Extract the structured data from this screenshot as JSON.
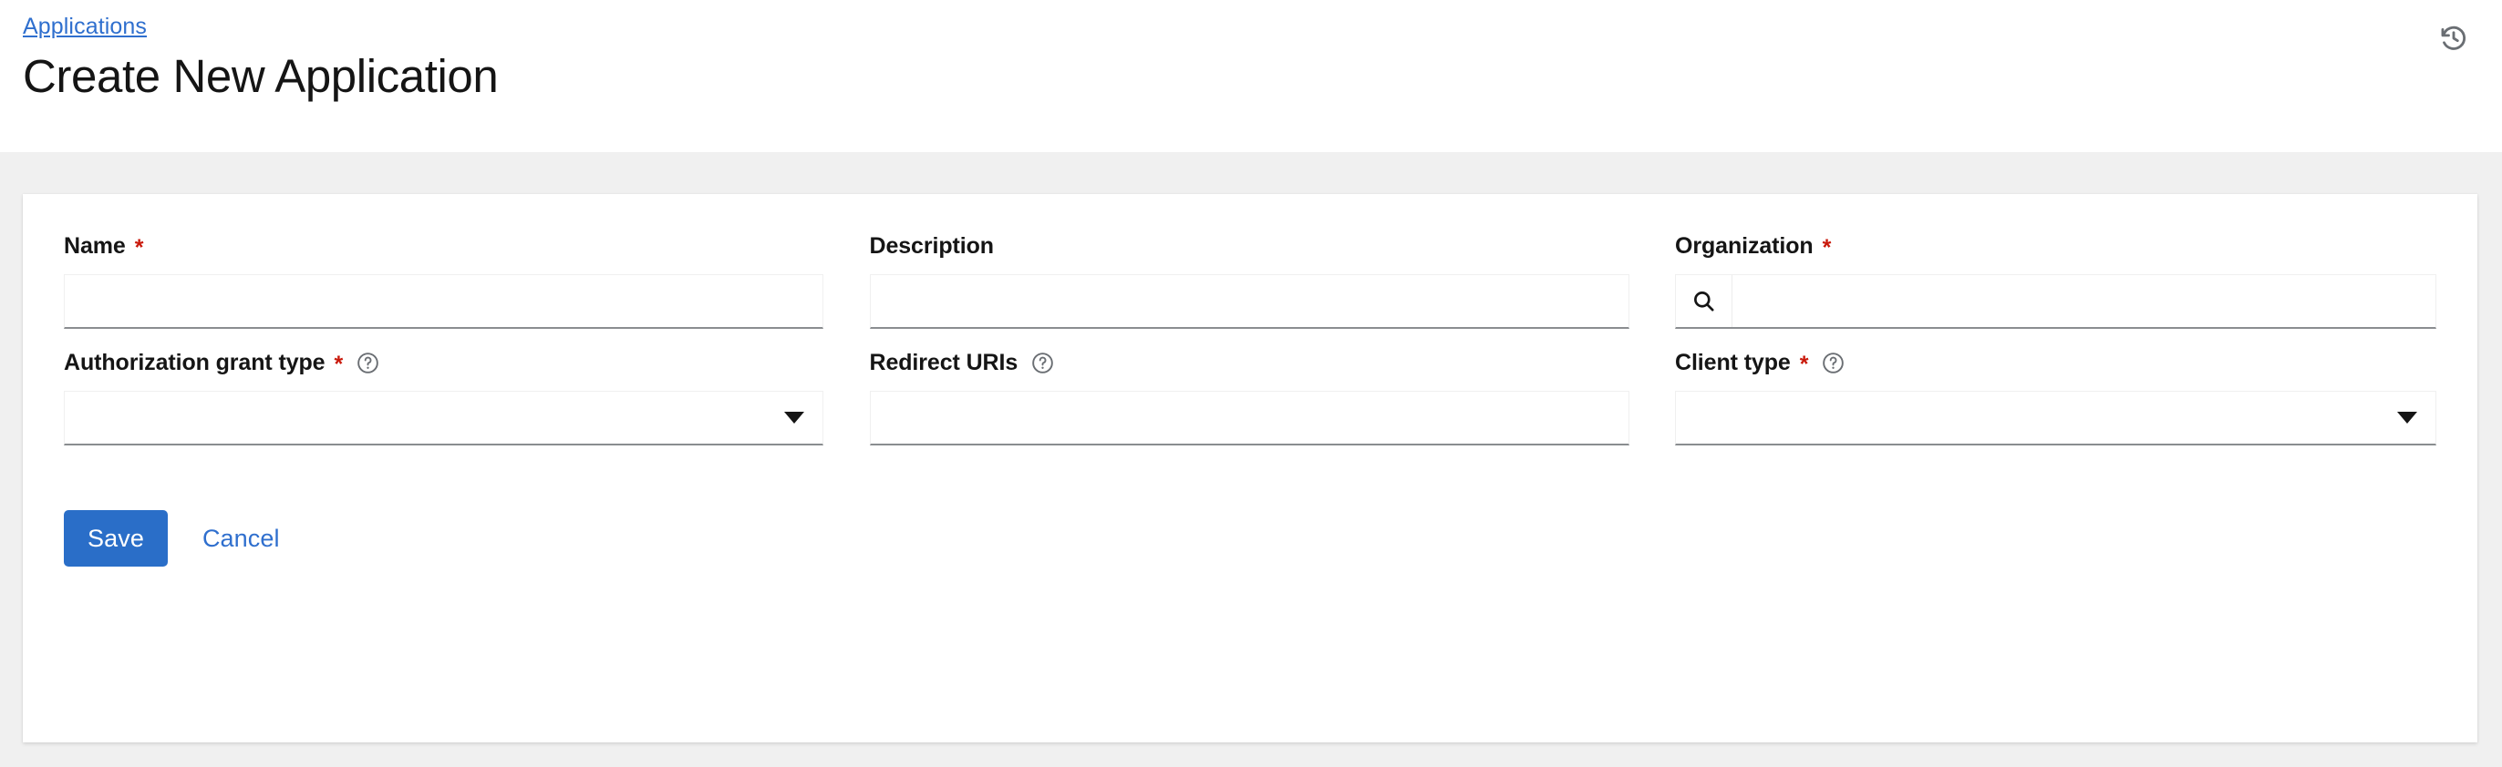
{
  "header": {
    "breadcrumb": "Applications",
    "title": "Create New Application",
    "history_icon": "history-icon"
  },
  "form": {
    "fields": [
      {
        "label": "Name",
        "required": true,
        "has_help": false,
        "type": "text",
        "value": "",
        "placeholder": ""
      },
      {
        "label": "Description",
        "required": false,
        "has_help": false,
        "type": "text",
        "value": "",
        "placeholder": ""
      },
      {
        "label": "Organization",
        "required": true,
        "has_help": false,
        "type": "lookup",
        "value": "",
        "placeholder": "",
        "search_icon": "search-icon"
      },
      {
        "label": "Authorization grant type",
        "required": true,
        "has_help": true,
        "type": "select",
        "value": "",
        "help_icon": "help-circle-icon",
        "caret_icon": "caret-down-icon"
      },
      {
        "label": "Redirect URIs",
        "required": false,
        "has_help": true,
        "type": "text",
        "value": "",
        "placeholder": "",
        "help_icon": "help-circle-icon"
      },
      {
        "label": "Client type",
        "required": true,
        "has_help": true,
        "type": "select",
        "value": "",
        "help_icon": "help-circle-icon",
        "caret_icon": "caret-down-icon"
      }
    ],
    "required_marker": "*"
  },
  "actions": {
    "save_label": "Save",
    "cancel_label": "Cancel"
  },
  "colors": {
    "link": "#2f6fce",
    "primary_button": "#2a6ec8",
    "required_asterisk": "#c9190b",
    "page_background": "#f0f0f0",
    "card_background": "#ffffff",
    "input_underline": "#8a8d90",
    "text": "#151515"
  }
}
